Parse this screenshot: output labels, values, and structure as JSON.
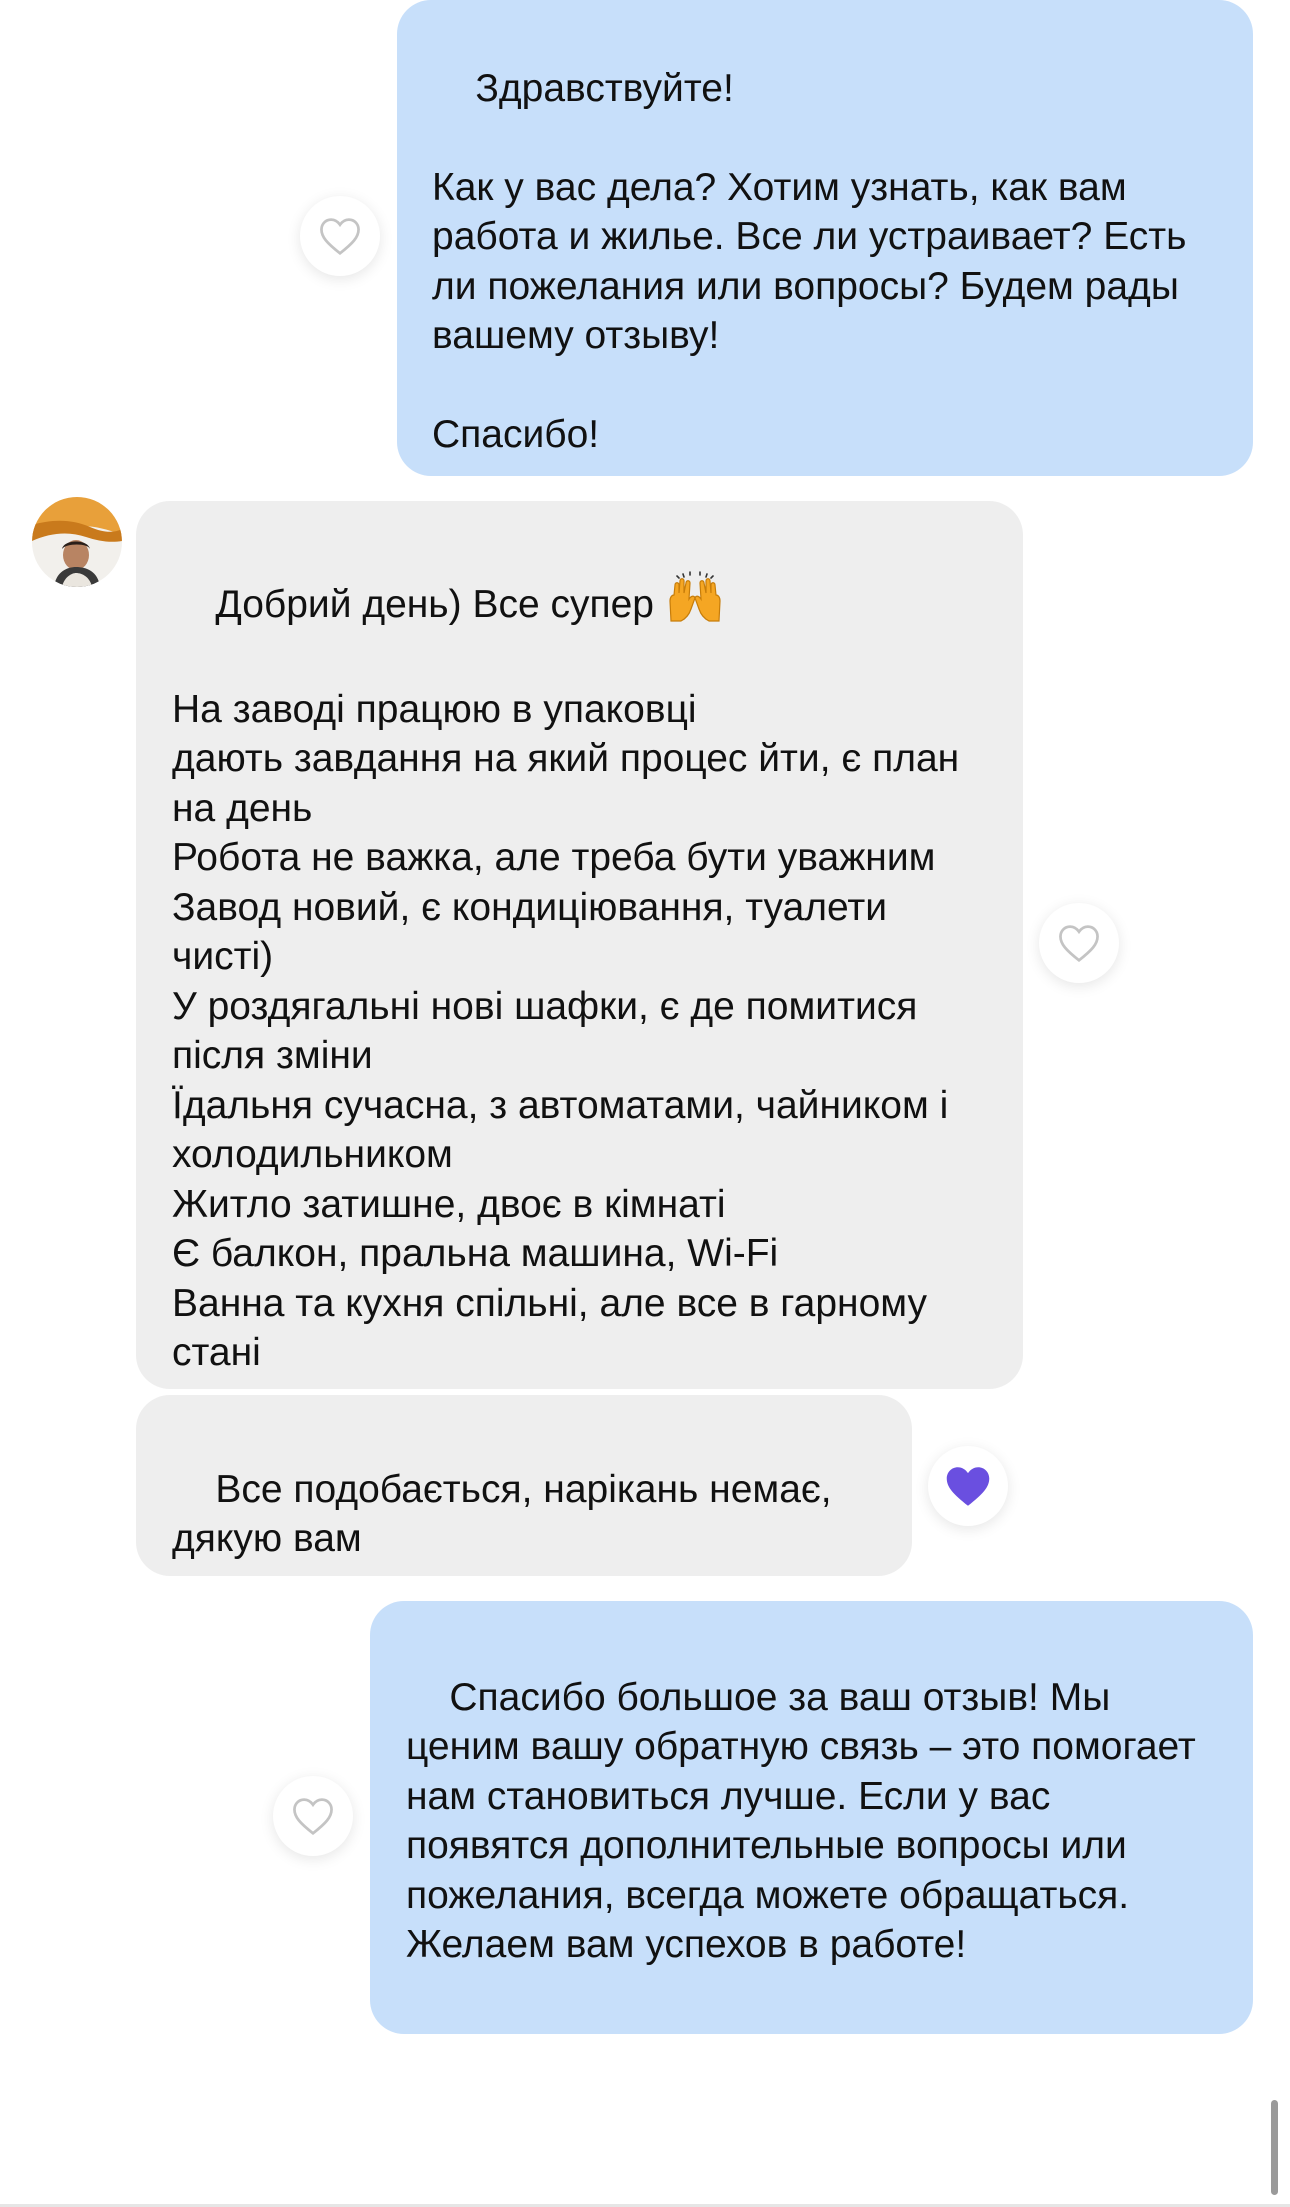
{
  "messages": [
    {
      "id": "msg1",
      "direction": "outgoing",
      "text": "Здравствуйте!\n\nКак у вас дела? Хотим узнать, как вам работа и жилье. Все ли устраивает? Есть ли пожелания или вопросы? Будем рады вашему отзыву!\n\nСпасибо!",
      "liked": false
    },
    {
      "id": "msg2",
      "direction": "incoming",
      "first_line": "Добрий день) Все супер",
      "emoji": "🙌",
      "text": "На заводі працюю в упаковці\nдають завдання на який процес йти, є план на день\nРобота не важка, але треба бути уважним\nЗавод новий, є кондиціювання, туалети чисті)\nУ роздягальні нові шафки, є де помитися після зміни\nЇдальня сучасна, з автоматами, чайником і холодильником\nЖитло затишне, двоє в кімнаті\nЄ балкон, пральна машина, Wi-Fi\nВанна та кухня спільні, але все в гарному стані",
      "liked": false
    },
    {
      "id": "msg3",
      "direction": "incoming",
      "text": "Все подобається, нарікань немає, дякую вам",
      "liked": true
    },
    {
      "id": "msg4",
      "direction": "outgoing",
      "text": "Спасибо большое за ваш отзыв! Мы ценим вашу обратную связь – это помогает нам становиться лучше. Если у вас появятся дополнительные вопросы или пожелания, всегда можете обращаться. Желаем вам успехов в работе!",
      "liked": false
    }
  ],
  "icons": {
    "like": "heart-outline-icon",
    "liked": "heart-filled-icon",
    "avatar": "contact-avatar"
  },
  "colors": {
    "outgoing_bubble": "#c7dffa",
    "incoming_bubble": "#eeeeee",
    "heart_outline": "#c4c4c4",
    "heart_filled": "#6a4fe0"
  }
}
